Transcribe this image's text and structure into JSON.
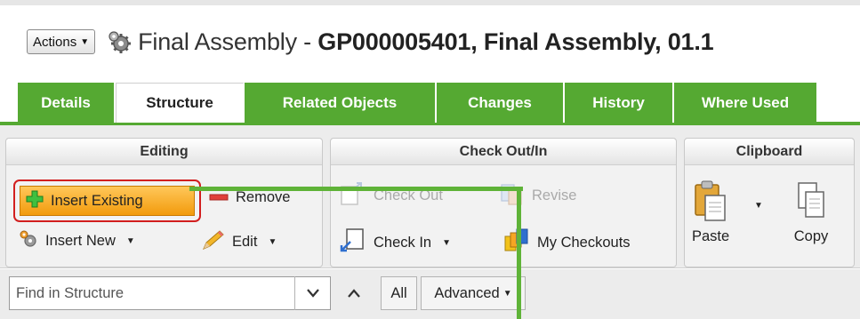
{
  "header": {
    "actions_label": "Actions",
    "title_normal": "Final Assembly - ",
    "title_bold": "GP000005401, Final Assembly, 01.1"
  },
  "tabs": [
    {
      "label": "Details",
      "active": false
    },
    {
      "label": "Structure",
      "active": true
    },
    {
      "label": "Related Objects",
      "active": false
    },
    {
      "label": "Changes",
      "active": false
    },
    {
      "label": "History",
      "active": false
    },
    {
      "label": "Where Used",
      "active": false
    }
  ],
  "ribbon": {
    "editing": {
      "title": "Editing",
      "insert_existing": "Insert Existing",
      "remove": "Remove",
      "insert_new": "Insert New",
      "edit": "Edit"
    },
    "checkout": {
      "title": "Check Out/In",
      "check_out": "Check Out",
      "revise": "Revise",
      "check_in": "Check In",
      "my_checkouts": "My Checkouts"
    },
    "clipboard": {
      "title": "Clipboard",
      "paste": "Paste",
      "copy": "Copy"
    }
  },
  "search": {
    "placeholder": "Find in Structure",
    "all_label": "All",
    "advanced_label": "Advanced"
  },
  "colors": {
    "tab_green": "#55a932",
    "highlight_orange": "#f29b0c",
    "highlight_border_red": "#d21f1f"
  }
}
